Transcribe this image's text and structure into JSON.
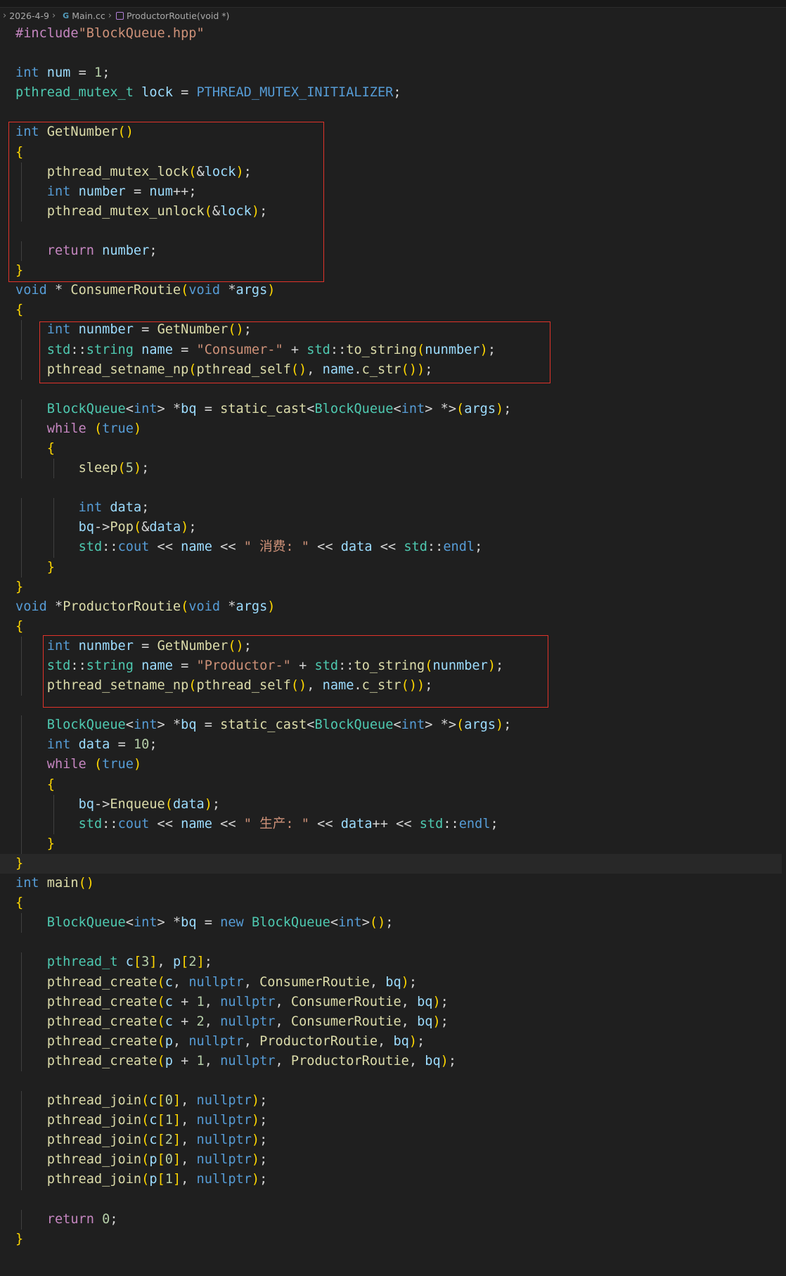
{
  "breadcrumb": {
    "folder": "2026-4-9",
    "file": "Main.cc",
    "symbol": "ProductorRoutie(void *)"
  },
  "code_lines": [
    "#include\"BlockQueue.hpp\"",
    "",
    "int num = 1;",
    "pthread_mutex_t lock = PTHREAD_MUTEX_INITIALIZER;",
    "",
    "int GetNumber()",
    "{",
    "    pthread_mutex_lock(&lock);",
    "    int number = num++;",
    "    pthread_mutex_unlock(&lock);",
    "",
    "    return number;",
    "}",
    "void * ConsumerRoutie(void *args)",
    "{",
    "    int nunmber = GetNumber();",
    "    std::string name = \"Consumer-\" + std::to_string(nunmber);",
    "    pthread_setname_np(pthread_self(), name.c_str());",
    "",
    "    BlockQueue<int> *bq = static_cast<BlockQueue<int> *>(args);",
    "    while (true)",
    "    {",
    "        sleep(5);",
    "",
    "        int data;",
    "        bq->Pop(&data);",
    "        std::cout << name << \" 消费: \" << data << std::endl;",
    "    }",
    "}",
    "void *ProductorRoutie(void *args)",
    "{",
    "    int nunmber = GetNumber();",
    "    std::string name = \"Productor-\" + std::to_string(nunmber);",
    "    pthread_setname_np(pthread_self(), name.c_str());",
    "",
    "    BlockQueue<int> *bq = static_cast<BlockQueue<int> *>(args);",
    "    int data = 10;",
    "    while (true)",
    "    {",
    "        bq->Enqueue(data);",
    "        std::cout << name << \" 生产: \" << data++ << std::endl;",
    "    }",
    "}",
    "int main()",
    "{",
    "    BlockQueue<int> *bq = new BlockQueue<int>();",
    "",
    "    pthread_t c[3], p[2];",
    "    pthread_create(c, nullptr, ConsumerRoutie, bq);",
    "    pthread_create(c + 1, nullptr, ConsumerRoutie, bq);",
    "    pthread_create(c + 2, nullptr, ConsumerRoutie, bq);",
    "    pthread_create(p, nullptr, ProductorRoutie, bq);",
    "    pthread_create(p + 1, nullptr, ProductorRoutie, bq);",
    "",
    "    pthread_join(c[0], nullptr);",
    "    pthread_join(c[1], nullptr);",
    "    pthread_join(c[2], nullptr);",
    "    pthread_join(p[0], nullptr);",
    "    pthread_join(p[1], nullptr);",
    "",
    "    return 0;",
    "}"
  ],
  "colors": {
    "background": "#1f1f1f",
    "annotation_box": "#e0332a",
    "keyword": "#569cd6",
    "type": "#4ec9b0",
    "function": "#dcdcaa",
    "string": "#ce9178",
    "number": "#b5cea8"
  }
}
